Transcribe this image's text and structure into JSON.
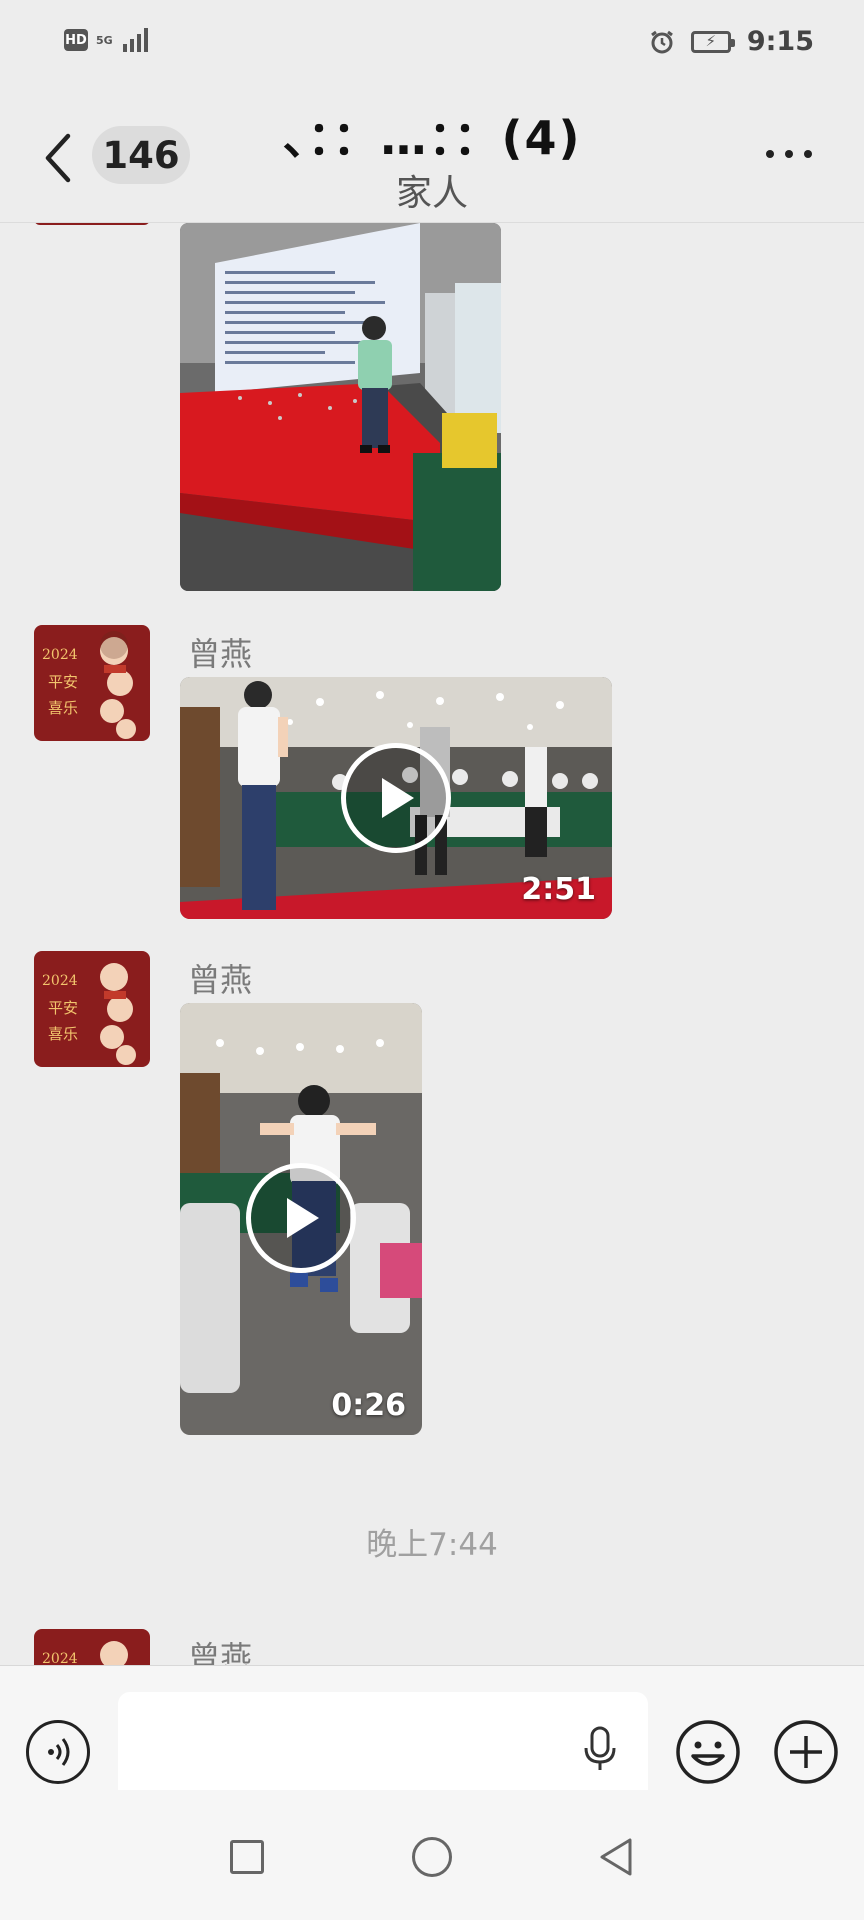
{
  "status_bar": {
    "hd_label": "HD",
    "network_label": "5G",
    "time": "9:15"
  },
  "header": {
    "unread_count": "146",
    "title": "、：：…：：(4)",
    "subtitle": "家人"
  },
  "messages": [
    {
      "type": "image"
    },
    {
      "type": "video",
      "sender": "曾燕",
      "duration": "2:51"
    },
    {
      "type": "video",
      "sender": "曾燕",
      "duration": "0:26"
    },
    {
      "type": "timestamp",
      "text": "晚上7:44"
    },
    {
      "type": "partial",
      "sender": "曾燕"
    }
  ],
  "colors": {
    "background": "#ededed",
    "avatar_red": "#8a1d1d",
    "stage_red": "#d8191f",
    "table_green": "#1f5a3c"
  },
  "icons": [
    "back-icon",
    "more-icon",
    "play-icon",
    "voice-icon",
    "microphone-icon",
    "emoji-icon",
    "plus-icon"
  ]
}
